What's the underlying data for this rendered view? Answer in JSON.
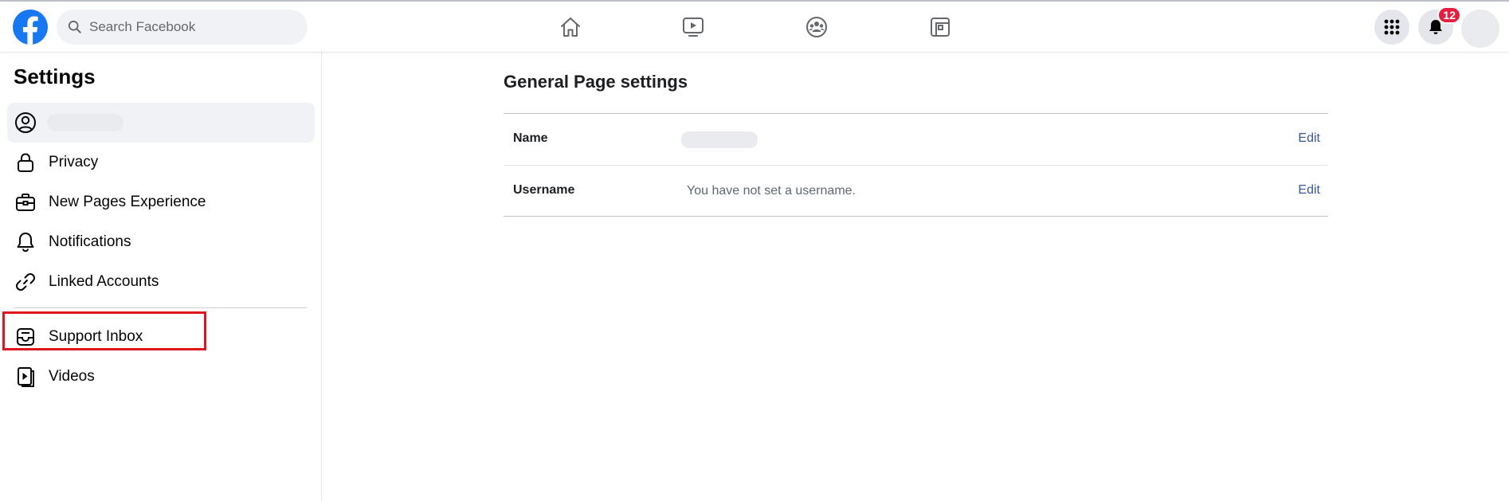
{
  "header": {
    "search_placeholder": "Search Facebook",
    "notifications_count": "12",
    "icons": {
      "logo": "facebook-logo",
      "home": "home-icon",
      "watch": "video-icon",
      "groups": "groups-icon",
      "pages": "pages-icon",
      "menu": "grid-menu-icon",
      "notifications": "bell-icon"
    }
  },
  "sidebar": {
    "title": "Settings",
    "items": [
      {
        "label": "",
        "icon": "user-circle-icon",
        "active": true
      },
      {
        "label": "Privacy",
        "icon": "lock-icon"
      },
      {
        "label": "New Pages Experience",
        "icon": "briefcase-icon"
      },
      {
        "label": "Notifications",
        "icon": "bell-outline-icon"
      },
      {
        "label": "Linked Accounts",
        "icon": "link-icon"
      },
      {
        "label": "Support Inbox",
        "icon": "inbox-icon"
      },
      {
        "label": "Videos",
        "icon": "video-file-icon"
      }
    ]
  },
  "main": {
    "title": "General Page settings",
    "rows": [
      {
        "label": "Name",
        "value": "",
        "action": "Edit"
      },
      {
        "label": "Username",
        "value": "You have not set a username.",
        "action": "Edit"
      }
    ]
  },
  "colors": {
    "brand": "#1877f2",
    "badge": "#e41e3f",
    "link": "#385898",
    "highlight": "#e0161e"
  }
}
